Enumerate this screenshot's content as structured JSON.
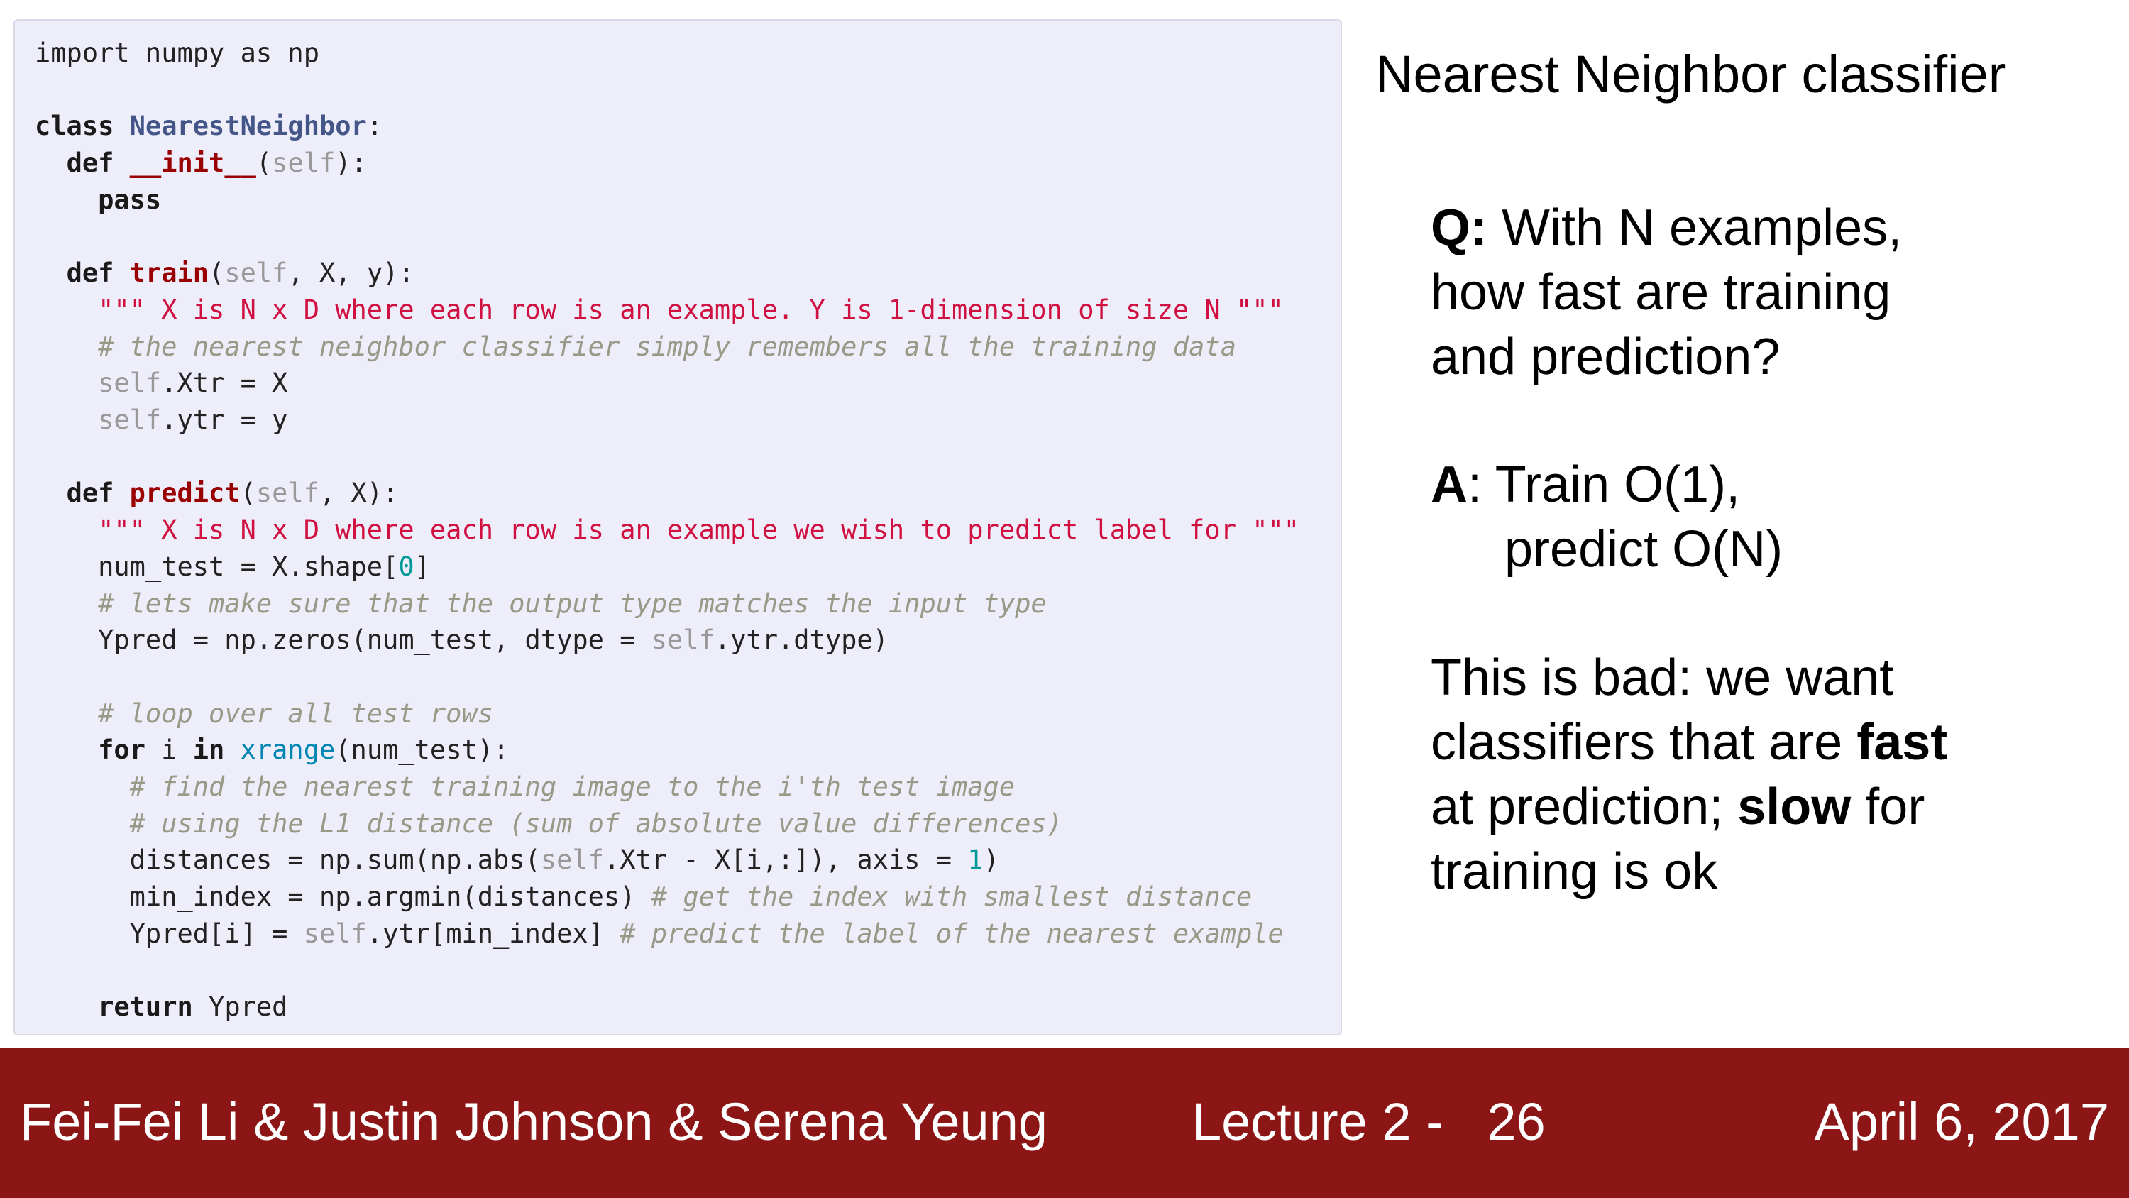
{
  "code": {
    "lines": [
      [
        {
          "t": "import numpy as np",
          "c": ""
        }
      ],
      [],
      [
        {
          "t": "class",
          "c": "kw"
        },
        {
          "t": " ",
          "c": ""
        },
        {
          "t": "NearestNeighbor",
          "c": "cls"
        },
        {
          "t": ":",
          "c": ""
        }
      ],
      [
        {
          "t": "  ",
          "c": ""
        },
        {
          "t": "def",
          "c": "kw"
        },
        {
          "t": " ",
          "c": ""
        },
        {
          "t": "__init__",
          "c": "fn"
        },
        {
          "t": "(",
          "c": ""
        },
        {
          "t": "self",
          "c": "self"
        },
        {
          "t": "):",
          "c": ""
        }
      ],
      [
        {
          "t": "    ",
          "c": ""
        },
        {
          "t": "pass",
          "c": "kw"
        }
      ],
      [],
      [
        {
          "t": "  ",
          "c": ""
        },
        {
          "t": "def",
          "c": "kw"
        },
        {
          "t": " ",
          "c": ""
        },
        {
          "t": "train",
          "c": "fn"
        },
        {
          "t": "(",
          "c": ""
        },
        {
          "t": "self",
          "c": "self"
        },
        {
          "t": ", X, y):",
          "c": ""
        }
      ],
      [
        {
          "t": "    ",
          "c": ""
        },
        {
          "t": "\"\"\" X is N x D where each row is an example. Y is 1-dimension of size N \"\"\"",
          "c": "str"
        }
      ],
      [
        {
          "t": "    ",
          "c": ""
        },
        {
          "t": "# the nearest neighbor classifier simply remembers all the training data",
          "c": "com"
        }
      ],
      [
        {
          "t": "    ",
          "c": ""
        },
        {
          "t": "self",
          "c": "self"
        },
        {
          "t": ".Xtr = X",
          "c": ""
        }
      ],
      [
        {
          "t": "    ",
          "c": ""
        },
        {
          "t": "self",
          "c": "self"
        },
        {
          "t": ".ytr = y",
          "c": ""
        }
      ],
      [],
      [
        {
          "t": "  ",
          "c": ""
        },
        {
          "t": "def",
          "c": "kw"
        },
        {
          "t": " ",
          "c": ""
        },
        {
          "t": "predict",
          "c": "fn"
        },
        {
          "t": "(",
          "c": ""
        },
        {
          "t": "self",
          "c": "self"
        },
        {
          "t": ", X):",
          "c": ""
        }
      ],
      [
        {
          "t": "    ",
          "c": ""
        },
        {
          "t": "\"\"\" X is N x D where each row is an example we wish to predict label for \"\"\"",
          "c": "str"
        }
      ],
      [
        {
          "t": "    num_test = X.shape[",
          "c": ""
        },
        {
          "t": "0",
          "c": "num"
        },
        {
          "t": "]",
          "c": ""
        }
      ],
      [
        {
          "t": "    ",
          "c": ""
        },
        {
          "t": "# lets make sure that the output type matches the input type",
          "c": "com"
        }
      ],
      [
        {
          "t": "    Ypred = np.zeros(num_test, dtype = ",
          "c": ""
        },
        {
          "t": "self",
          "c": "self"
        },
        {
          "t": ".ytr.dtype)",
          "c": ""
        }
      ],
      [],
      [
        {
          "t": "    ",
          "c": ""
        },
        {
          "t": "# loop over all test rows",
          "c": "com"
        }
      ],
      [
        {
          "t": "    ",
          "c": ""
        },
        {
          "t": "for",
          "c": "kw"
        },
        {
          "t": " i ",
          "c": ""
        },
        {
          "t": "in",
          "c": "kw"
        },
        {
          "t": " ",
          "c": ""
        },
        {
          "t": "xrange",
          "c": "bi"
        },
        {
          "t": "(num_test):",
          "c": ""
        }
      ],
      [
        {
          "t": "      ",
          "c": ""
        },
        {
          "t": "# find the nearest training image to the i'th test image",
          "c": "com"
        }
      ],
      [
        {
          "t": "      ",
          "c": ""
        },
        {
          "t": "# using the L1 distance (sum of absolute value differences)",
          "c": "com"
        }
      ],
      [
        {
          "t": "      distances = np.sum(np.abs(",
          "c": ""
        },
        {
          "t": "self",
          "c": "self"
        },
        {
          "t": ".Xtr - X[i,:]), axis = ",
          "c": ""
        },
        {
          "t": "1",
          "c": "num"
        },
        {
          "t": ")",
          "c": ""
        }
      ],
      [
        {
          "t": "      min_index = np.argmin(distances) ",
          "c": ""
        },
        {
          "t": "# get the index with smallest distance",
          "c": "com"
        }
      ],
      [
        {
          "t": "      Ypred[i] = ",
          "c": ""
        },
        {
          "t": "self",
          "c": "self"
        },
        {
          "t": ".ytr[min_index] ",
          "c": ""
        },
        {
          "t": "# predict the label of the nearest example",
          "c": "com"
        }
      ],
      [],
      [
        {
          "t": "    ",
          "c": ""
        },
        {
          "t": "return",
          "c": "kw"
        },
        {
          "t": " Ypred",
          "c": ""
        }
      ]
    ]
  },
  "side": {
    "title": "Nearest Neighbor classifier",
    "q_label": "Q:",
    "q_line1": " With N examples,",
    "q_line2": "how fast are training",
    "q_line3": "and prediction?",
    "a_label": "A",
    "a_line1": ": Train O(1),",
    "a_line2": "predict O(N)",
    "bad_line1": "This is bad: we want",
    "bad_line2_pre": "classifiers that are ",
    "bad_line2_bold": "fast",
    "bad_line3_pre": "at prediction; ",
    "bad_line3_bold": "slow",
    "bad_line3_post": " for",
    "bad_line4": "training is ok"
  },
  "footer": {
    "authors": "Fei-Fei Li & Justin Johnson & Serena Yeung",
    "lecture": "Lecture 2 -   26",
    "date": "April 6, 2017",
    "bg_color": "#8c1515"
  }
}
